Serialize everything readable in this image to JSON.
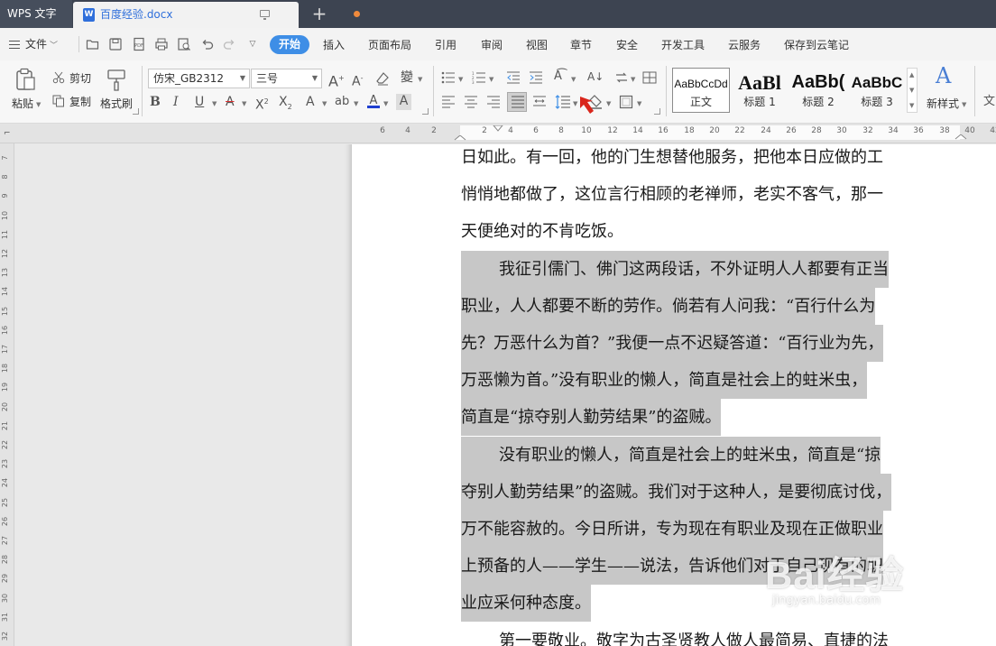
{
  "titlebar": {
    "app_name": "WPS 文字",
    "doc_tab": "百度经验.docx",
    "doc_icon_letter": "W",
    "new_tab": "+"
  },
  "menubar": {
    "file_label": "文件",
    "tabs": [
      "开始",
      "插入",
      "页面布局",
      "引用",
      "审阅",
      "视图",
      "章节",
      "安全",
      "开发工具",
      "云服务",
      "保存到云笔记"
    ],
    "active_tab": "开始"
  },
  "ribbon": {
    "paste": "粘贴",
    "cut": "剪切",
    "copy": "复制",
    "format_painter": "格式刷",
    "font_name": "仿宋_GB2312",
    "font_size": "三号",
    "styles": [
      {
        "sample": "AaBbCcDd",
        "name": "正文"
      },
      {
        "sample": "AaBl",
        "name": "标题 1"
      },
      {
        "sample": "AaBb(",
        "name": "标题 2"
      },
      {
        "sample": "AaBbC",
        "name": "标题 3"
      }
    ],
    "new_style": "新样式",
    "new_style_sample": "A",
    "accent_color": "#3e8ee6",
    "pointer_color": "#d9261c"
  },
  "ruler": {
    "h_numbers": [
      "6",
      "4",
      "2",
      "",
      "2",
      "4",
      "6",
      "8",
      "10",
      "12",
      "14",
      "16",
      "18",
      "20",
      "22",
      "24",
      "26",
      "28",
      "30",
      "32",
      "34",
      "36",
      "38",
      "40",
      "42"
    ],
    "v_numbers": [
      "7",
      "8",
      "9",
      "10",
      "11",
      "12",
      "13",
      "14",
      "15",
      "16",
      "17",
      "18",
      "19",
      "20",
      "21",
      "22",
      "23",
      "24",
      "25",
      "26",
      "27",
      "28",
      "29",
      "30",
      "31",
      "32"
    ]
  },
  "document": {
    "lines": [
      {
        "text": "日如此。有一回，他的门生想替他服务，把他本日应做的工",
        "highlight": false
      },
      {
        "text": "悄悄地都做了，这位言行相顾的老禅师，老实不客气，那一",
        "highlight": false
      },
      {
        "text": "天便绝对的不肯吃饭。",
        "highlight": false
      },
      {
        "text": "我征引儒门、佛门这两段话，不外证明人人都要有正当",
        "highlight": true,
        "indent": true
      },
      {
        "text": "职业，人人都要不断的劳作。倘若有人问我：“百行什么为",
        "highlight": true
      },
      {
        "text": "先？万恶什么为首？”我便一点不迟疑答道：“百行业为先，",
        "highlight": true
      },
      {
        "text": "万恶懒为首。”没有职业的懒人，简直是社会上的蛀米虫，",
        "highlight": true
      },
      {
        "text": "简直是“掠夺别人勤劳结果”的盗贼。",
        "highlight": true
      },
      {
        "text": "没有职业的懒人，简直是社会上的蛀米虫，简直是“掠",
        "highlight": true,
        "indent": true
      },
      {
        "text": "夺别人勤劳结果”的盗贼。我们对于这种人，是要彻底讨伐，",
        "highlight": true
      },
      {
        "text": "万不能容赦的。今日所讲，专为现在有职业及现在正做职业",
        "highlight": true
      },
      {
        "text": "上预备的人——学生——说法，告诉他们对于自己现有的职",
        "highlight": true
      },
      {
        "text": "业应采何种态度。",
        "highlight": true
      },
      {
        "text": "第一要敬业。敬字为古圣贤教人做人最简易、直捷的法",
        "highlight": false,
        "indent": true
      }
    ]
  },
  "watermark": {
    "brand": "Bai经验",
    "url": "jingyan.baidu.com"
  }
}
